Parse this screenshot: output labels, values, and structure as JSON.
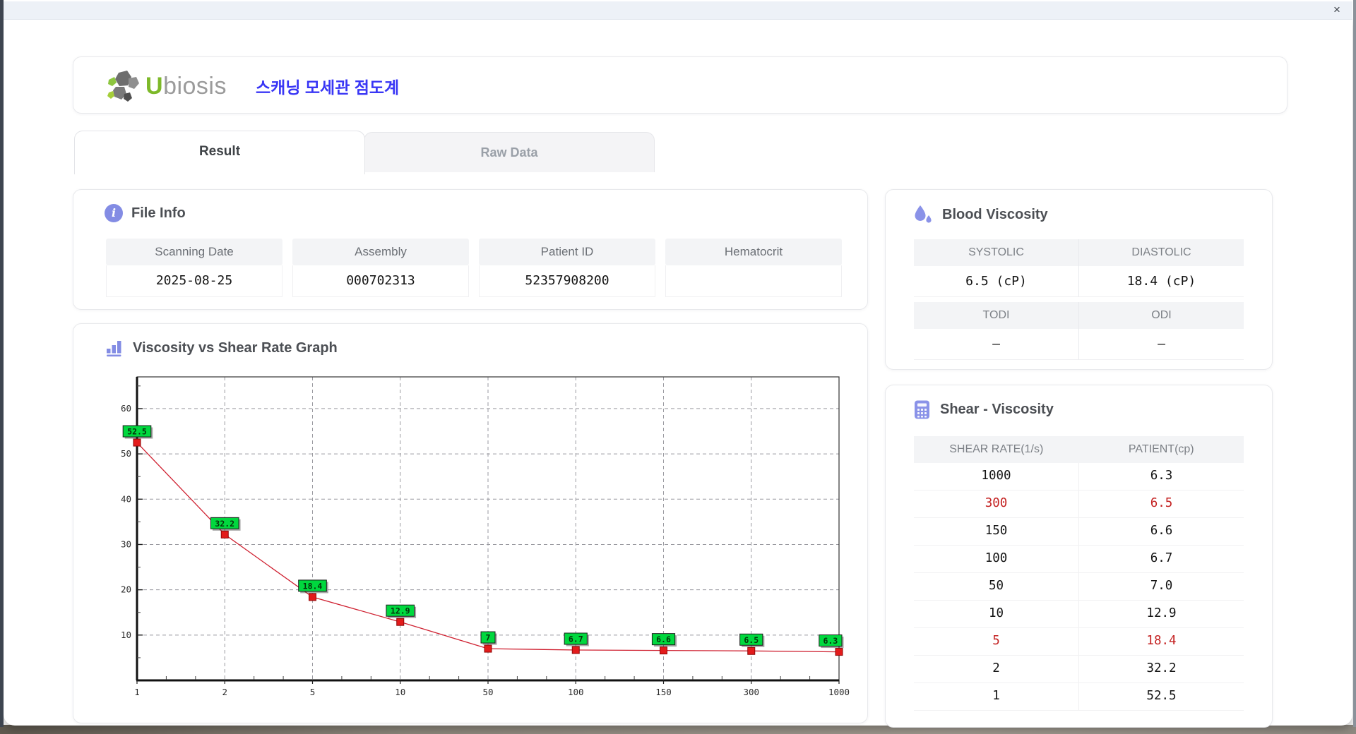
{
  "icons": {
    "close": "×",
    "info": "i"
  },
  "header": {
    "logo_u": "U",
    "logo_rest": "biosis",
    "app_title": "스캐닝 모세관 점도계"
  },
  "tabs": {
    "result": "Result",
    "raw_data": "Raw Data"
  },
  "file_info": {
    "title": "File Info",
    "fields": [
      {
        "label": "Scanning Date",
        "value": "2025-08-25"
      },
      {
        "label": "Assembly",
        "value": "000702313"
      },
      {
        "label": "Patient ID",
        "value": "52357908200"
      },
      {
        "label": "Hematocrit",
        "value": ""
      }
    ]
  },
  "blood_viscosity": {
    "title": "Blood Viscosity",
    "systolic_label": "SYSTOLIC",
    "systolic_value": "6.5 (cP)",
    "diastolic_label": "DIASTOLIC",
    "diastolic_value": "18.4 (cP)",
    "todi_label": "TODI",
    "todi_value": "–",
    "odi_label": "ODI",
    "odi_value": "–"
  },
  "graph_section": {
    "title": "Viscosity vs Shear Rate Graph"
  },
  "chart_data": {
    "type": "line",
    "x": [
      1,
      2,
      5,
      10,
      50,
      100,
      150,
      300,
      1000
    ],
    "x_tick_labels": [
      "1",
      "2",
      "5",
      "10",
      "50",
      "100",
      "150",
      "300",
      "1000"
    ],
    "series": [
      {
        "name": "PATIENT",
        "values": [
          52.5,
          32.2,
          18.4,
          12.9,
          7.0,
          6.7,
          6.6,
          6.5,
          6.3
        ]
      }
    ],
    "point_labels": [
      "52.5",
      "32.2",
      "18.4",
      "12.9",
      "7",
      "6.7",
      "6.6",
      "6.5",
      "6.3"
    ],
    "yticks": [
      10,
      20,
      30,
      40,
      50,
      60
    ],
    "ylim": [
      0,
      67
    ],
    "grid": "dashed",
    "legend": "none",
    "line_color": "#cf2030",
    "marker_color": "#e31b1b",
    "point_label_bg": "#00d83e"
  },
  "shear_table": {
    "title": "Shear - Viscosity",
    "columns": [
      "SHEAR RATE(1/s)",
      "PATIENT(cp)"
    ],
    "highlight_color": "#c42222",
    "rows": [
      {
        "shear": "1000",
        "patient": "6.3",
        "highlight": false
      },
      {
        "shear": "300",
        "patient": "6.5",
        "highlight": true
      },
      {
        "shear": "150",
        "patient": "6.6",
        "highlight": false
      },
      {
        "shear": "100",
        "patient": "6.7",
        "highlight": false
      },
      {
        "shear": "50",
        "patient": "7.0",
        "highlight": false
      },
      {
        "shear": "10",
        "patient": "12.9",
        "highlight": false
      },
      {
        "shear": "5",
        "patient": "18.4",
        "highlight": true
      },
      {
        "shear": "2",
        "patient": "32.2",
        "highlight": false
      },
      {
        "shear": "1",
        "patient": "52.5",
        "highlight": false
      }
    ]
  }
}
